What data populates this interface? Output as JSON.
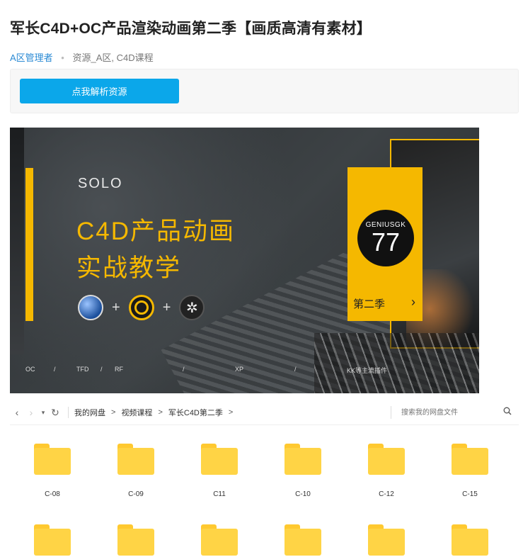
{
  "post": {
    "title": "军长C4D+OC产品渲染动画第二季【画质高清有素材】",
    "author": "A区管理者",
    "categories": "资源_A区, C4D课程",
    "parse_button": "点我解析资源"
  },
  "banner": {
    "brand": "SOLO",
    "headline_1": "C4D产品动画",
    "headline_2": "实战教学",
    "plus": "+",
    "badge_top": "GENIUSGK",
    "badge_num": "77",
    "season": "第二季",
    "chevron": "›",
    "footer": [
      "OC",
      "/",
      "TFD",
      "/",
      "RF",
      "/",
      "XP",
      "/",
      "KK等主流插件"
    ]
  },
  "navbar": {
    "back": "‹",
    "forward": "›",
    "dropdown": "▾",
    "refresh": "↻",
    "crumbs": [
      "我的网盘",
      "视频课程",
      "军长C4D第二季"
    ],
    "arrow": ">",
    "search_placeholder": "搜索我的网盘文件"
  },
  "folders": {
    "row1": [
      "C-08",
      "C-09",
      "C11",
      "C-10",
      "C-12",
      "C-15"
    ],
    "row2": [
      "",
      "",
      "",
      "",
      "",
      ""
    ]
  },
  "colors": {
    "accent_yellow": "#f5b800",
    "button_blue": "#0ba7ea",
    "folder_yellow": "#ffd445"
  }
}
